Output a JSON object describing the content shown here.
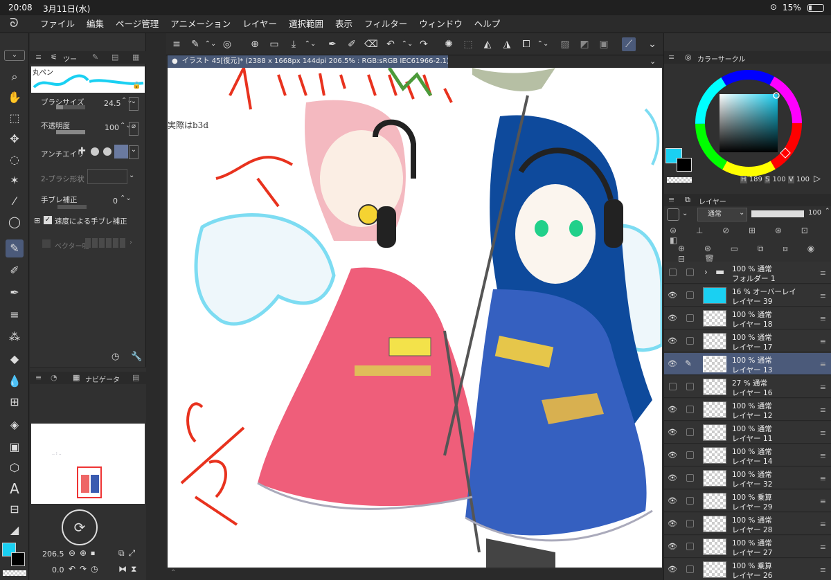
{
  "status": {
    "time": "20:08",
    "date": "3月11日(水)",
    "battery": "15%"
  },
  "menu": [
    "ファイル",
    "編集",
    "ページ管理",
    "アニメーション",
    "レイヤー",
    "選択範囲",
    "表示",
    "フィルター",
    "ウィンドウ",
    "ヘルプ"
  ],
  "tool_panel": {
    "tab_label": "ツー",
    "brush_name": "丸ペン",
    "brush_size_label": "ブラシサイズ",
    "brush_size_value": "24.5",
    "opacity_label": "不透明度",
    "opacity_value": "100",
    "antialias_label": "アンチエイリ",
    "brush_shape_label": "2-ブラシ形状",
    "stabilization_label": "手ブレ補正",
    "stabilization_value": "0",
    "speed_stab_label": "速度による手ブレ補正",
    "vector_label": "ベクター吸"
  },
  "navigator": {
    "tab_label": "ナビゲータ",
    "zoom_value": "206.5",
    "rotate_value": "0.0"
  },
  "canvas": {
    "title": "イラスト 45[復元]* (2388 x 1668px 144dpi 206.5% : RGB:sRGB IEC61966-2.1)",
    "handwriting": "実際はb3d"
  },
  "color_panel": {
    "title": "カラーサークル",
    "h": "189",
    "s": "100",
    "v": "100",
    "h_label": "H",
    "s_label": "S",
    "v_label": "V",
    "fg": "#1ad0f2",
    "bg": "#000000"
  },
  "layer_panel": {
    "title": "レイヤー",
    "blend_mode": "通常",
    "opacity": "100",
    "layers": [
      {
        "mode": "100 % 通常",
        "name": "フォルダー 1",
        "type": "folder"
      },
      {
        "mode": "16 % オーバーレイ",
        "name": "レイヤー 39",
        "type": "cyan"
      },
      {
        "mode": "100 % 通常",
        "name": "レイヤー 18"
      },
      {
        "mode": "100 % 通常",
        "name": "レイヤー 17"
      },
      {
        "mode": "100 % 通常",
        "name": "レイヤー 13",
        "selected": true
      },
      {
        "mode": "27 % 通常",
        "name": "レイヤー 16"
      },
      {
        "mode": "100 % 通常",
        "name": "レイヤー 12"
      },
      {
        "mode": "100 % 通常",
        "name": "レイヤー 11"
      },
      {
        "mode": "100 % 通常",
        "name": "レイヤー 14"
      },
      {
        "mode": "100 % 通常",
        "name": "レイヤー 32"
      },
      {
        "mode": "100 % 乗算",
        "name": "レイヤー 29"
      },
      {
        "mode": "100 % 通常",
        "name": "レイヤー 28"
      },
      {
        "mode": "100 % 通常",
        "name": "レイヤー 27"
      },
      {
        "mode": "100 % 乗算",
        "name": "レイヤー 26"
      }
    ]
  }
}
